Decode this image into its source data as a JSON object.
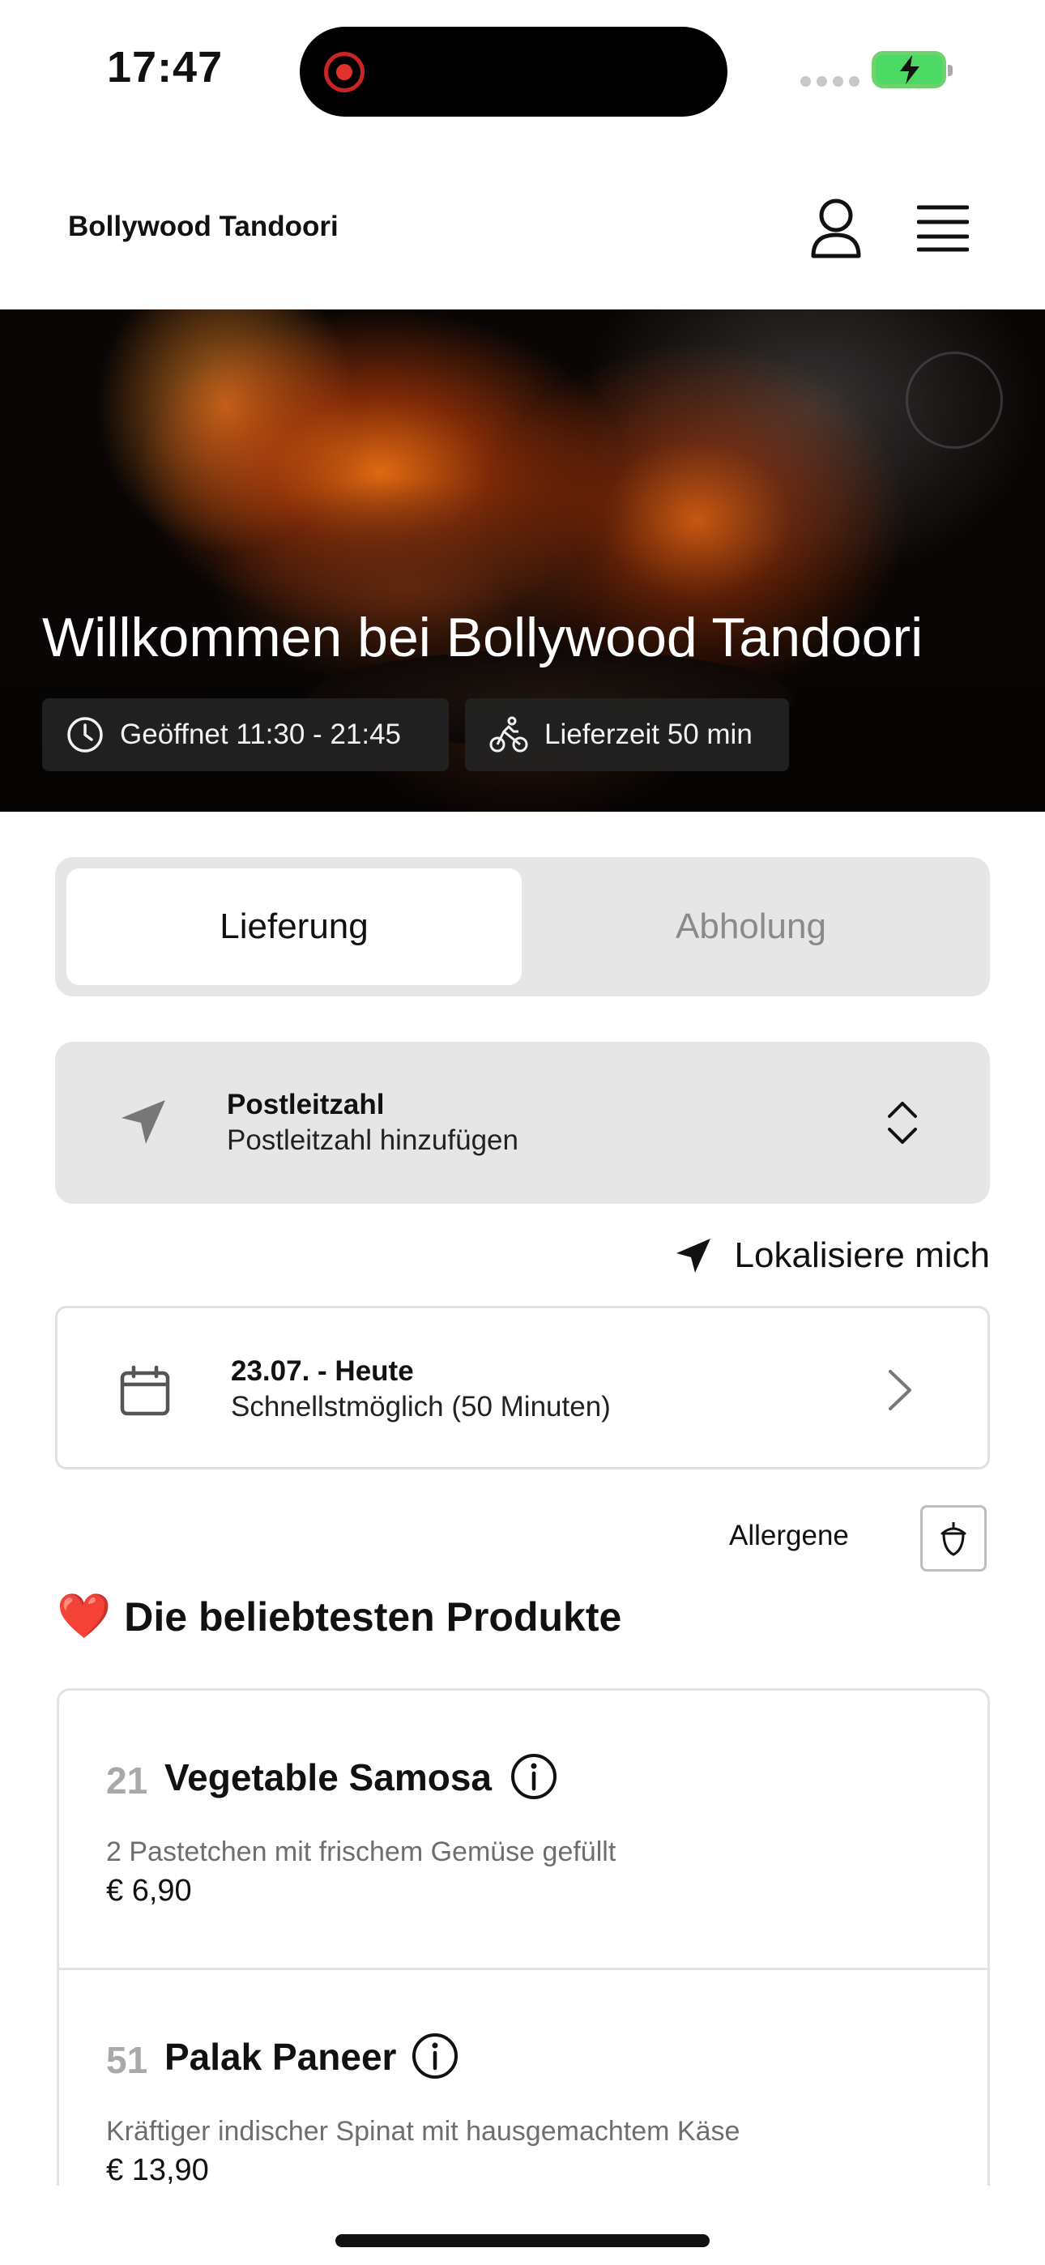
{
  "status_bar": {
    "time": "17:47"
  },
  "header": {
    "brand": "Bollywood Tandoori"
  },
  "hero": {
    "title": "Willkommen bei Bollywood Tandoori",
    "opening_hours": "Geöffnet 11:30 - 21:45",
    "delivery_time": "Lieferzeit 50 min"
  },
  "order_mode": {
    "options": [
      "Lieferung",
      "Abholung"
    ],
    "selected": "Lieferung"
  },
  "postcode": {
    "label": "Postleitzahl",
    "placeholder": "Postleitzahl hinzufügen"
  },
  "locate": {
    "label": "Lokalisiere mich"
  },
  "schedule": {
    "date": "23.07. - Heute",
    "time": "Schnellstmöglich (50 Minuten)"
  },
  "allergens": {
    "label": "Allergene"
  },
  "popular": {
    "emoji": "❤️",
    "title": "Die beliebtesten Produkte",
    "products": [
      {
        "number": "21",
        "name": "Vegetable Samosa",
        "description": "2 Pastetchen mit frischem Gemüse gefüllt",
        "price": "€ 6,90"
      },
      {
        "number": "51",
        "name": "Palak Paneer",
        "description": "Kräftiger indischer Spinat mit hausgemachtem Käse",
        "price": "€ 13,90"
      }
    ]
  },
  "colors": {
    "battery": "#4cd964",
    "recording": "#e0312d",
    "panel_bg": "#e6e6e6"
  }
}
